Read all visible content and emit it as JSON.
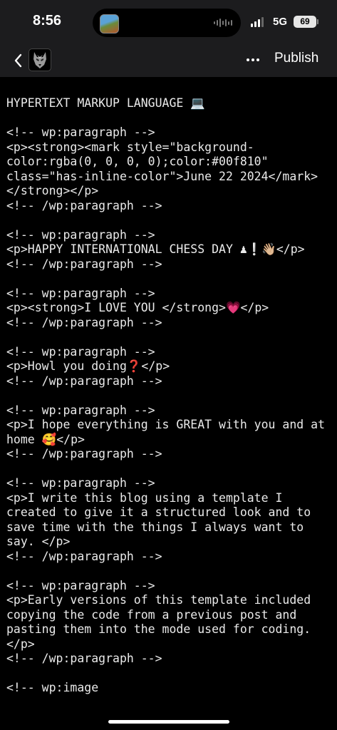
{
  "status_bar": {
    "time": "8:56",
    "network": "5G",
    "battery": "69"
  },
  "nav": {
    "back_icon": "chevron-left-icon",
    "site_icon": "wolf-avatar-icon",
    "more_icon": "ellipsis-icon",
    "publish_label": "Publish"
  },
  "editor": {
    "content": "HYPERTEXT MARKUP LANGUAGE 💻\n\n<!-- wp:paragraph -->\n<p><strong><mark style=\"background-color:rgba(0, 0, 0, 0);color:#00f810\" class=\"has-inline-color\">June 22 2024</mark></strong></p>\n<!-- /wp:paragraph -->\n\n<!-- wp:paragraph -->\n<p>HAPPY INTERNATIONAL CHESS DAY ♟❕👋🏼</p>\n<!-- /wp:paragraph -->\n\n<!-- wp:paragraph -->\n<p><strong>I LOVE YOU </strong>💗</p>\n<!-- /wp:paragraph -->\n\n<!-- wp:paragraph -->\n<p>Howl you doing❓</p>\n<!-- /wp:paragraph -->\n\n<!-- wp:paragraph -->\n<p>I hope everything is GREAT with you and at home 🥰</p>\n<!-- /wp:paragraph -->\n\n<!-- wp:paragraph -->\n<p>I write this blog using a template I created to give it a structured look and to save time with the things I always want to say. </p>\n<!-- /wp:paragraph -->\n\n<!-- wp:paragraph -->\n<p>Early versions of this template included copying the code from a previous post and pasting them into the mode used for coding. </p>\n<!-- /wp:paragraph -->\n\n<!-- wp:image"
  },
  "colors": {
    "bar_background": "#1c1c1e",
    "editor_background": "#000000",
    "text": "#eaeaea"
  }
}
